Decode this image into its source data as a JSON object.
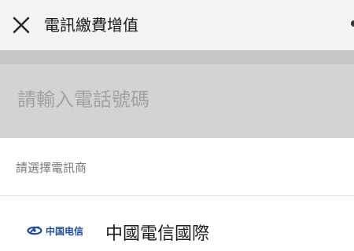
{
  "header": {
    "title": "電訊繳費增值"
  },
  "phone_input": {
    "placeholder": "請輸入電話號碼",
    "value": ""
  },
  "carrier_section": {
    "label": "請選擇電訊商"
  },
  "carriers": [
    {
      "logo_text": "中国电信",
      "name": "中國電信國際",
      "brand_color": "#1f4f9c"
    }
  ],
  "colors": {
    "header_bg": "#f3f3f3",
    "input_bg": "#d3d3d3",
    "placeholder": "#a2a2a2",
    "section_label": "#7a7a7a"
  }
}
